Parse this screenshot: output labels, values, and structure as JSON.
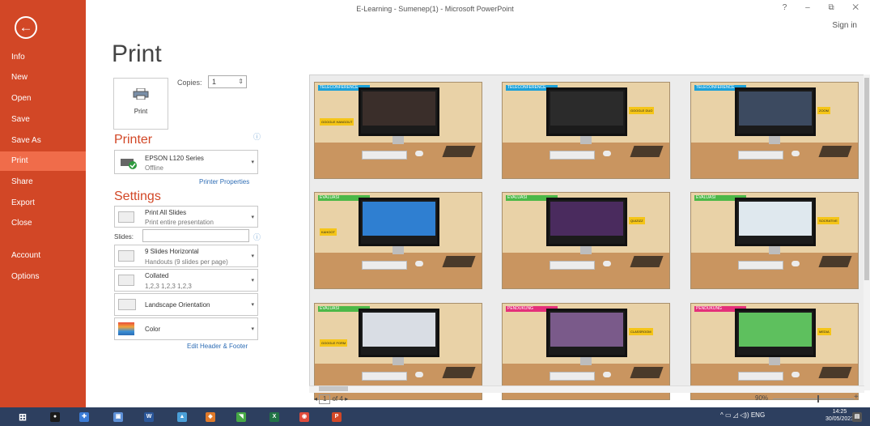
{
  "window": {
    "title": "E-Learning - Sumenep(1) - Microsoft PowerPoint",
    "controls": "? – ⧉ ✕",
    "sign_in": "Sign in"
  },
  "sidebar": {
    "back_glyph": "←",
    "items": [
      {
        "label": "Info"
      },
      {
        "label": "New"
      },
      {
        "label": "Open"
      },
      {
        "label": "Save"
      },
      {
        "label": "Save As"
      },
      {
        "label": "Print",
        "active": true
      },
      {
        "label": "Share"
      },
      {
        "label": "Export"
      },
      {
        "label": "Close"
      },
      {
        "label": "Account"
      },
      {
        "label": "Options"
      }
    ]
  },
  "print": {
    "page_title": "Print",
    "button_label": "Print",
    "copies_label": "Copies:",
    "copies_value": "1",
    "spin_glyph": "⇕"
  },
  "printer": {
    "section_title": "Printer",
    "info_glyph": "ⓘ",
    "name": "EPSON L120 Series",
    "status": "Offline",
    "properties_link": "Printer Properties"
  },
  "settings": {
    "section_title": "Settings",
    "dropdowns": [
      {
        "line1": "Print All Slides",
        "line2": "Print entire presentation"
      },
      {
        "line1": "9 Slides Horizontal",
        "line2": "Handouts (9 slides per page)"
      },
      {
        "line1": "Collated",
        "line2": "1,2,3   1,2,3   1,2,3"
      },
      {
        "line1": "Landscape Orientation",
        "line2": ""
      },
      {
        "line1": "Color",
        "line2": ""
      }
    ],
    "slides_label": "Slides:",
    "slides_value": "",
    "edit_link": "Edit Header & Footer",
    "arrow_glyph": "▾"
  },
  "preview": {
    "slides": [
      {
        "banner": "TELECONFERENCE",
        "banner_color": "#1da1d8",
        "tag": "GOOGLE HANGOUT",
        "screen_color": "#3a2e2a"
      },
      {
        "banner": "TELECONFERENCE",
        "banner_color": "#1da1d8",
        "tag": "GOOGLE DUO",
        "screen_color": "#2b2b2b"
      },
      {
        "banner": "TELECONFERENCE",
        "banner_color": "#1da1d8",
        "tag": "ZOOM",
        "screen_color": "#3c4a60"
      },
      {
        "banner": "EVALUASI",
        "banner_color": "#4cb848",
        "tag": "KAHOOT",
        "screen_color": "#2f7fd1"
      },
      {
        "banner": "EVALUASI",
        "banner_color": "#4cb848",
        "tag": "QUIZIZZ",
        "screen_color": "#4a2b5e"
      },
      {
        "banner": "EVALUASI",
        "banner_color": "#4cb848",
        "tag": "SOCRATIVE",
        "screen_color": "#dfe8ee"
      },
      {
        "banner": "EVALUASI",
        "banner_color": "#4cb848",
        "tag": "GOOGLE FORM",
        "screen_color": "#d9dde4"
      },
      {
        "banner": "PENDUKUNG",
        "banner_color": "#e4307a",
        "tag": "CLASSROOM",
        "screen_color": "#7a5a8a"
      },
      {
        "banner": "PENDUKUNG",
        "banner_color": "#e4307a",
        "tag": "MEDIA",
        "screen_color": "#5ec05e"
      }
    ],
    "page_current": "1",
    "page_total": "of 4",
    "zoom": "90%"
  },
  "taskbar": {
    "apps": [
      {
        "name": "windows-start-icon",
        "color": "#ffffff",
        "glyph": "⊞"
      },
      {
        "name": "camera-app-icon",
        "color": "#1b1b1b",
        "glyph": "●"
      },
      {
        "name": "settings-app-icon",
        "color": "#3a7bd5",
        "glyph": "✚"
      },
      {
        "name": "monitor-app-icon",
        "color": "#5c8fd6",
        "glyph": "▣"
      },
      {
        "name": "word-app-icon",
        "color": "#2b579a",
        "glyph": "W"
      },
      {
        "name": "photos-app-icon",
        "color": "#4a9fd8",
        "glyph": "▲"
      },
      {
        "name": "paint-app-icon",
        "color": "#e07a2a",
        "glyph": "◆"
      },
      {
        "name": "green-app-icon",
        "color": "#45a845",
        "glyph": "◥"
      },
      {
        "name": "excel-app-icon",
        "color": "#217346",
        "glyph": "X"
      },
      {
        "name": "chrome-app-icon",
        "color": "#e04b3b",
        "glyph": "◉"
      },
      {
        "name": "powerpoint-app-icon",
        "color": "#d24726",
        "glyph": "P"
      }
    ],
    "tray": "^  ▭  ◿  ◁))  ENG",
    "time": "14:25",
    "date": "30/05/2021"
  }
}
